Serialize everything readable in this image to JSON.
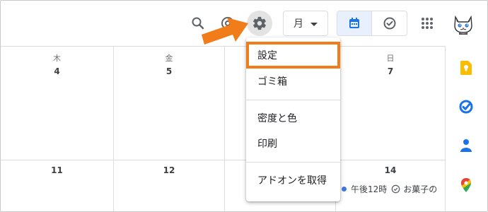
{
  "header": {
    "search_icon": "search-icon",
    "support_icon": "support-icon",
    "settings_icon": "gear-icon",
    "view_select_value": "月",
    "calendar_toggle_icon": "calendar-icon",
    "tasks_toggle_icon": "check-circle-icon",
    "apps_icon": "apps-grid-icon",
    "avatar_icon": "cat-avatar-icon"
  },
  "calendar": {
    "row1": [
      {
        "dow": "木",
        "day": "4"
      },
      {
        "dow": "金",
        "day": "5"
      },
      {
        "dow": "",
        "day": ""
      },
      {
        "dow": "日",
        "day": "7"
      }
    ],
    "row2": [
      {
        "day": "11"
      },
      {
        "day": "12"
      },
      {
        "day": ""
      },
      {
        "day": "14"
      }
    ],
    "event": {
      "time": "午後12時",
      "title": "お菓子の"
    }
  },
  "menu": {
    "items": [
      {
        "label": "設定"
      },
      {
        "label": "ゴミ箱"
      },
      {
        "label": "密度と色"
      },
      {
        "label": "印刷"
      },
      {
        "label": "アドオンを取得"
      }
    ]
  },
  "side_panel": {
    "icons": [
      "keep-icon",
      "tasks-icon",
      "contacts-icon",
      "maps-icon"
    ]
  },
  "colors": {
    "accent_blue": "#1a73e8",
    "highlight_orange": "#f07c1a",
    "keep_yellow": "#fbbc04",
    "maps_red": "#ea4335",
    "maps_green": "#34a853"
  }
}
